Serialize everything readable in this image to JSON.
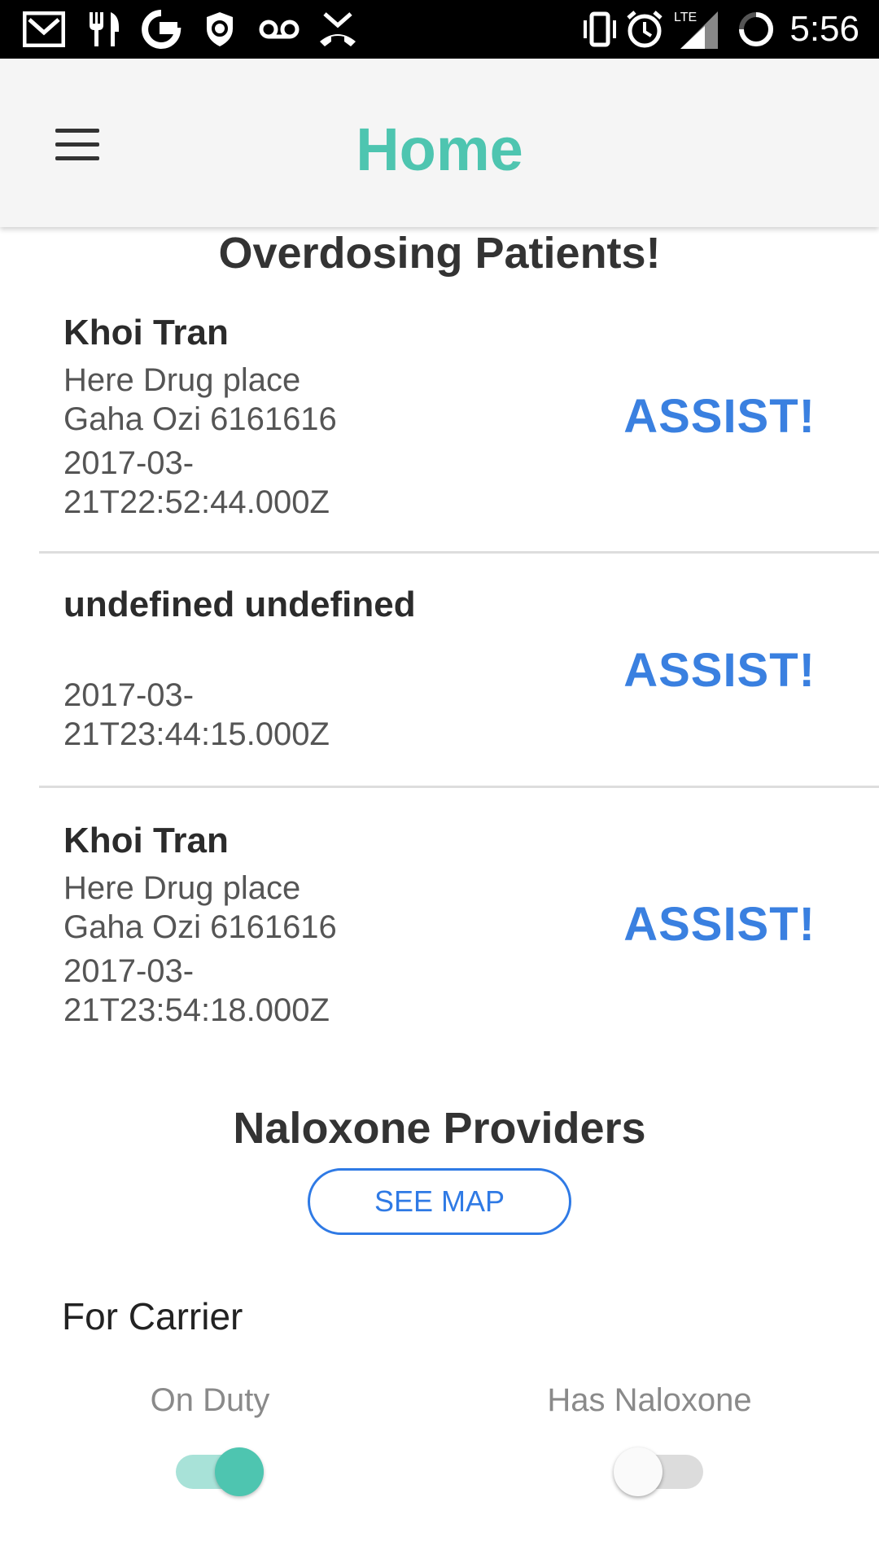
{
  "status_bar": {
    "time": "5:56",
    "network": "LTE",
    "icons": [
      "gmail-icon",
      "restaurant-icon",
      "google-icon",
      "shield-g-icon",
      "voicemail-icon",
      "missed-call-icon",
      "vibrate-icon",
      "alarm-icon",
      "lte-signal-icon",
      "loading-circle-icon"
    ]
  },
  "app_bar": {
    "title": "Home",
    "menu_icon": "hamburger-menu-icon",
    "title_color": "#4ec5b0"
  },
  "patients_section": {
    "title": "Overdosing Patients!",
    "items": [
      {
        "name": "Khoi Tran",
        "address_line1": "Here Drug place",
        "address_line2": "Gaha Ozi 6161616",
        "timestamp_line1": "2017-03-",
        "timestamp_line2": "21T22:52:44.000Z",
        "action_label": "ASSIST!"
      },
      {
        "name": "undefined undefined",
        "address_line1": "",
        "address_line2": "",
        "timestamp_line1": "2017-03-",
        "timestamp_line2": "21T23:44:15.000Z",
        "action_label": "ASSIST!"
      },
      {
        "name": "Khoi Tran",
        "address_line1": "Here Drug place",
        "address_line2": "Gaha Ozi 6161616",
        "timestamp_line1": "2017-03-",
        "timestamp_line2": "21T23:54:18.000Z",
        "action_label": "ASSIST!"
      }
    ],
    "accent_color": "#3a80e0"
  },
  "providers_section": {
    "title": "Naloxone Providers",
    "see_map_label": "SEE MAP"
  },
  "carrier_section": {
    "title": "For Carrier",
    "toggles": [
      {
        "label": "On Duty",
        "on": true
      },
      {
        "label": "Has Naloxone",
        "on": false
      }
    ],
    "switch_on_color": "#4ec5b0"
  }
}
